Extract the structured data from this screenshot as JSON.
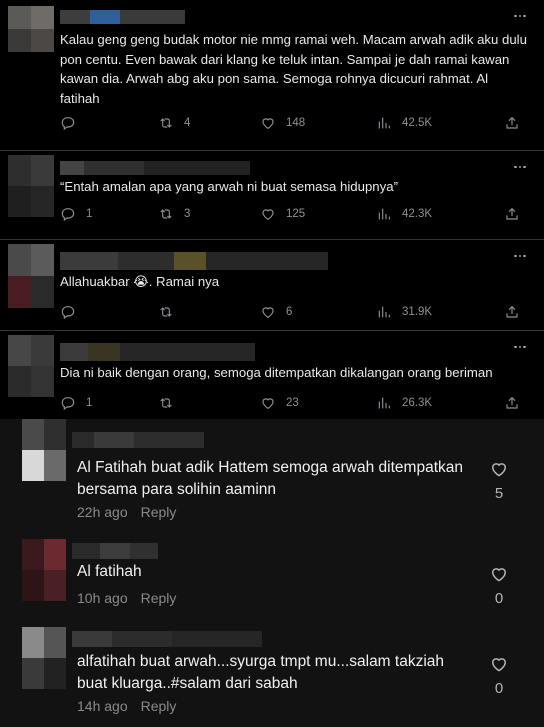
{
  "tweets": [
    {
      "text": "Kalau geng geng budak motor nie mmg ramai weh. Macam arwah adik aku dulu pon centu. Even bawak dari klang ke teluk intan. Sampai je dah ramai kawan kawan dia. Arwah abg aku pon sama. Semoga rohnya dicucuri rahmat. Al fatihah",
      "replies": "",
      "retweets": "4",
      "likes": "148",
      "views": "42.5K"
    },
    {
      "text": "“Entah amalan apa yang arwah ni buat semasa hidupnya”",
      "replies": "1",
      "retweets": "3",
      "likes": "125",
      "views": "42.3K"
    },
    {
      "text": "Allahuakbar 😭. Ramai nya",
      "replies": "",
      "retweets": "",
      "likes": "6",
      "views": "31.9K"
    },
    {
      "text": "Dia ni baik dengan orang, semoga ditempatkan dikalangan orang beriman",
      "replies": "1",
      "retweets": "",
      "likes": "23",
      "views": "26.3K"
    }
  ],
  "comments": [
    {
      "text": "Al Fatihah buat adik Hattem semoga arwah ditempatkan bersama para solihin aaminn",
      "time": "22h ago",
      "reply_label": "Reply",
      "likes": "5"
    },
    {
      "text": "Al fatihah",
      "time": "10h ago",
      "reply_label": "Reply",
      "likes": "0"
    },
    {
      "text": "alfatihah buat arwah...syurga tmpt mu...salam takziah buat kluarga..#salam dari sabah",
      "time": "14h ago",
      "reply_label": "Reply",
      "likes": "0"
    }
  ],
  "icons": {
    "reply": "reply-icon",
    "retweet": "retweet-icon",
    "like": "heart-icon",
    "views": "views-chart-icon",
    "share": "share-icon",
    "more": "more-dots-icon"
  },
  "colors": {
    "tweet_bg": "#000000",
    "comment_bg": "#121212",
    "muted": "#8b9197",
    "text": "#e7e9ea"
  }
}
